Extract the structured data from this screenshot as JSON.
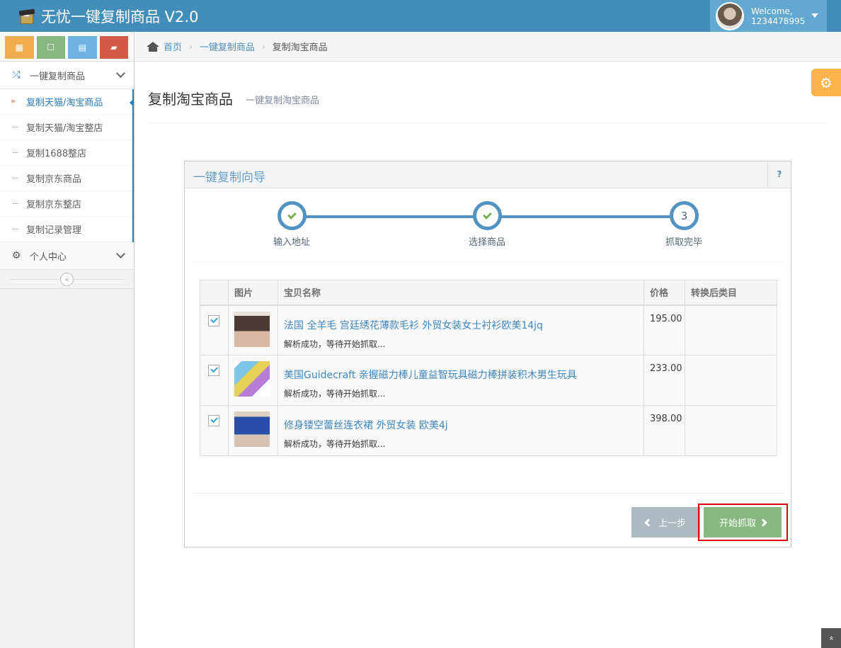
{
  "app": {
    "title": "无忧一键复制商品 V2.0"
  },
  "user": {
    "welcome": "Welcome,",
    "name": "1234478995"
  },
  "shortcuts": [
    {
      "icon": "calendar-icon",
      "glyph": "▦"
    },
    {
      "icon": "square-icon",
      "glyph": "☐"
    },
    {
      "icon": "grid-icon",
      "glyph": "▤"
    },
    {
      "icon": "book-icon",
      "glyph": "▰"
    }
  ],
  "sidebar": {
    "group1": {
      "label": "一键复制商品",
      "icon": "shuffle-icon"
    },
    "items": [
      {
        "label": "复制天猫/淘宝商品"
      },
      {
        "label": "复制天猫/淘宝整店"
      },
      {
        "label": "复制1688整店"
      },
      {
        "label": "复制京东商品"
      },
      {
        "label": "复制京东整店"
      },
      {
        "label": "复制记录管理"
      }
    ],
    "group2": {
      "label": "个人中心",
      "icon": "gear-icon"
    },
    "collapse_glyph": "«"
  },
  "breadcrumb": {
    "home": "首页",
    "section": "一键复制商品",
    "current": "复制淘宝商品",
    "sep": "›"
  },
  "page": {
    "title": "复制淘宝商品",
    "subtitle": "一键复制淘宝商品"
  },
  "settings_glyph": "⚙",
  "wizard": {
    "title": "一键复制向导",
    "help": "?",
    "steps": [
      {
        "label": "输入地址",
        "done": true
      },
      {
        "label": "选择商品",
        "done": true
      },
      {
        "label": "抓取完毕",
        "done": false,
        "number": "3"
      }
    ]
  },
  "table": {
    "headers": [
      "",
      "图片",
      "宝贝名称",
      "价格",
      "转换后类目"
    ],
    "rows": [
      {
        "name": "法国 全羊毛 宫廷绣花薄款毛衫 外贸女装女士衬衫欧美14jq",
        "status": "解析成功，等待开始抓取...",
        "price": "195.00",
        "category": ""
      },
      {
        "name": "美国Guidecraft 亲握磁力棒儿童益智玩具磁力棒拼装积木男生玩具",
        "status": "解析成功，等待开始抓取...",
        "price": "233.00",
        "category": ""
      },
      {
        "name": "修身镂空蕾丝连衣裙 外贸女装 欧美4j",
        "status": "解析成功，等待开始抓取...",
        "price": "398.00",
        "category": ""
      }
    ]
  },
  "buttons": {
    "prev": "上一步",
    "start": "开始抓取"
  },
  "scroll_top_glyph": "»",
  "colors": {
    "navbar": "#438eb9",
    "accent": "#2b7dbc",
    "success": "#87b87f",
    "step": "#5293c4",
    "highlight": "#e00000"
  }
}
